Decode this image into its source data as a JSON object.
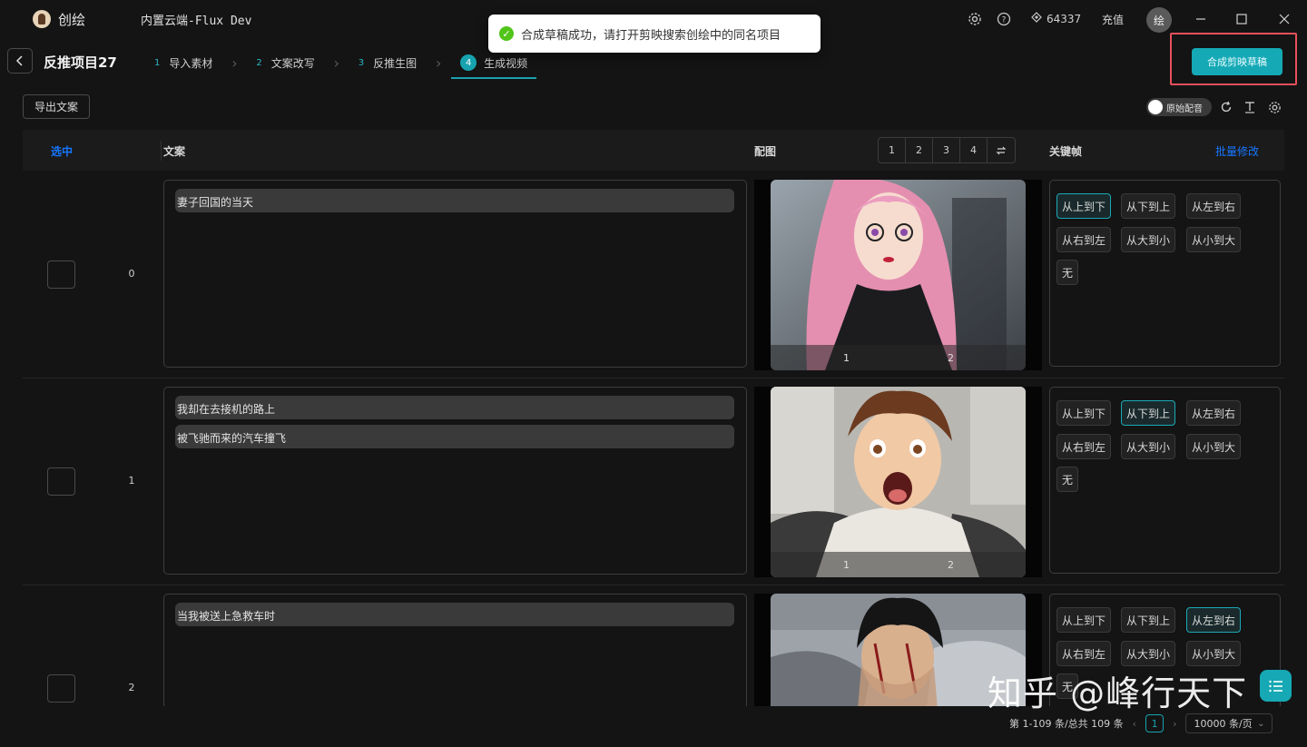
{
  "app": {
    "name": "创绘",
    "model": "内置云端-Flux Dev",
    "credits": "64337",
    "recharge": "充值",
    "avatar": "绘"
  },
  "toast": {
    "text": "合成草稿成功，请打开剪映搜索创绘中的同名项目"
  },
  "header": {
    "project_title": "反推项目27",
    "compose_button": "合成剪映草稿",
    "steps": [
      {
        "num": "1",
        "label": "导入素材"
      },
      {
        "num": "2",
        "label": "文案改写"
      },
      {
        "num": "3",
        "label": "反推生图"
      },
      {
        "num": "4",
        "label": "生成视频"
      }
    ]
  },
  "toolbar": {
    "export_button": "导出文案",
    "toggle_label": "原始配音"
  },
  "table": {
    "headers": {
      "select": "选中",
      "text": "文案",
      "image": "配图",
      "keyframe": "关键帧",
      "batch": "批量修改"
    },
    "image_tabs": [
      "1",
      "2",
      "3",
      "4"
    ],
    "rows": [
      {
        "index": "0",
        "lines": [
          "妻子回国的当天"
        ],
        "img_nums": [
          "1",
          "2"
        ],
        "selected_kf": 0
      },
      {
        "index": "1",
        "lines": [
          "我却在去接机的路上",
          "被飞驰而来的汽车撞飞"
        ],
        "img_nums": [
          "1",
          "2"
        ],
        "selected_kf": 1
      },
      {
        "index": "2",
        "lines": [
          "当我被送上急救车时"
        ],
        "img_nums": [],
        "selected_kf": 2
      }
    ],
    "keyframes": [
      "从上到下",
      "从下到上",
      "从左到右",
      "从右到左",
      "从大到小",
      "从小到大",
      "无"
    ]
  },
  "pagination": {
    "summary": "第 1-109 条/总共 109 条",
    "current": "1",
    "page_size": "10000 条/页"
  },
  "watermark": "知乎 @峰行天下",
  "colors": {
    "accent": "#17a2b0",
    "link": "#1677ff",
    "toast_success": "#52c41a"
  }
}
